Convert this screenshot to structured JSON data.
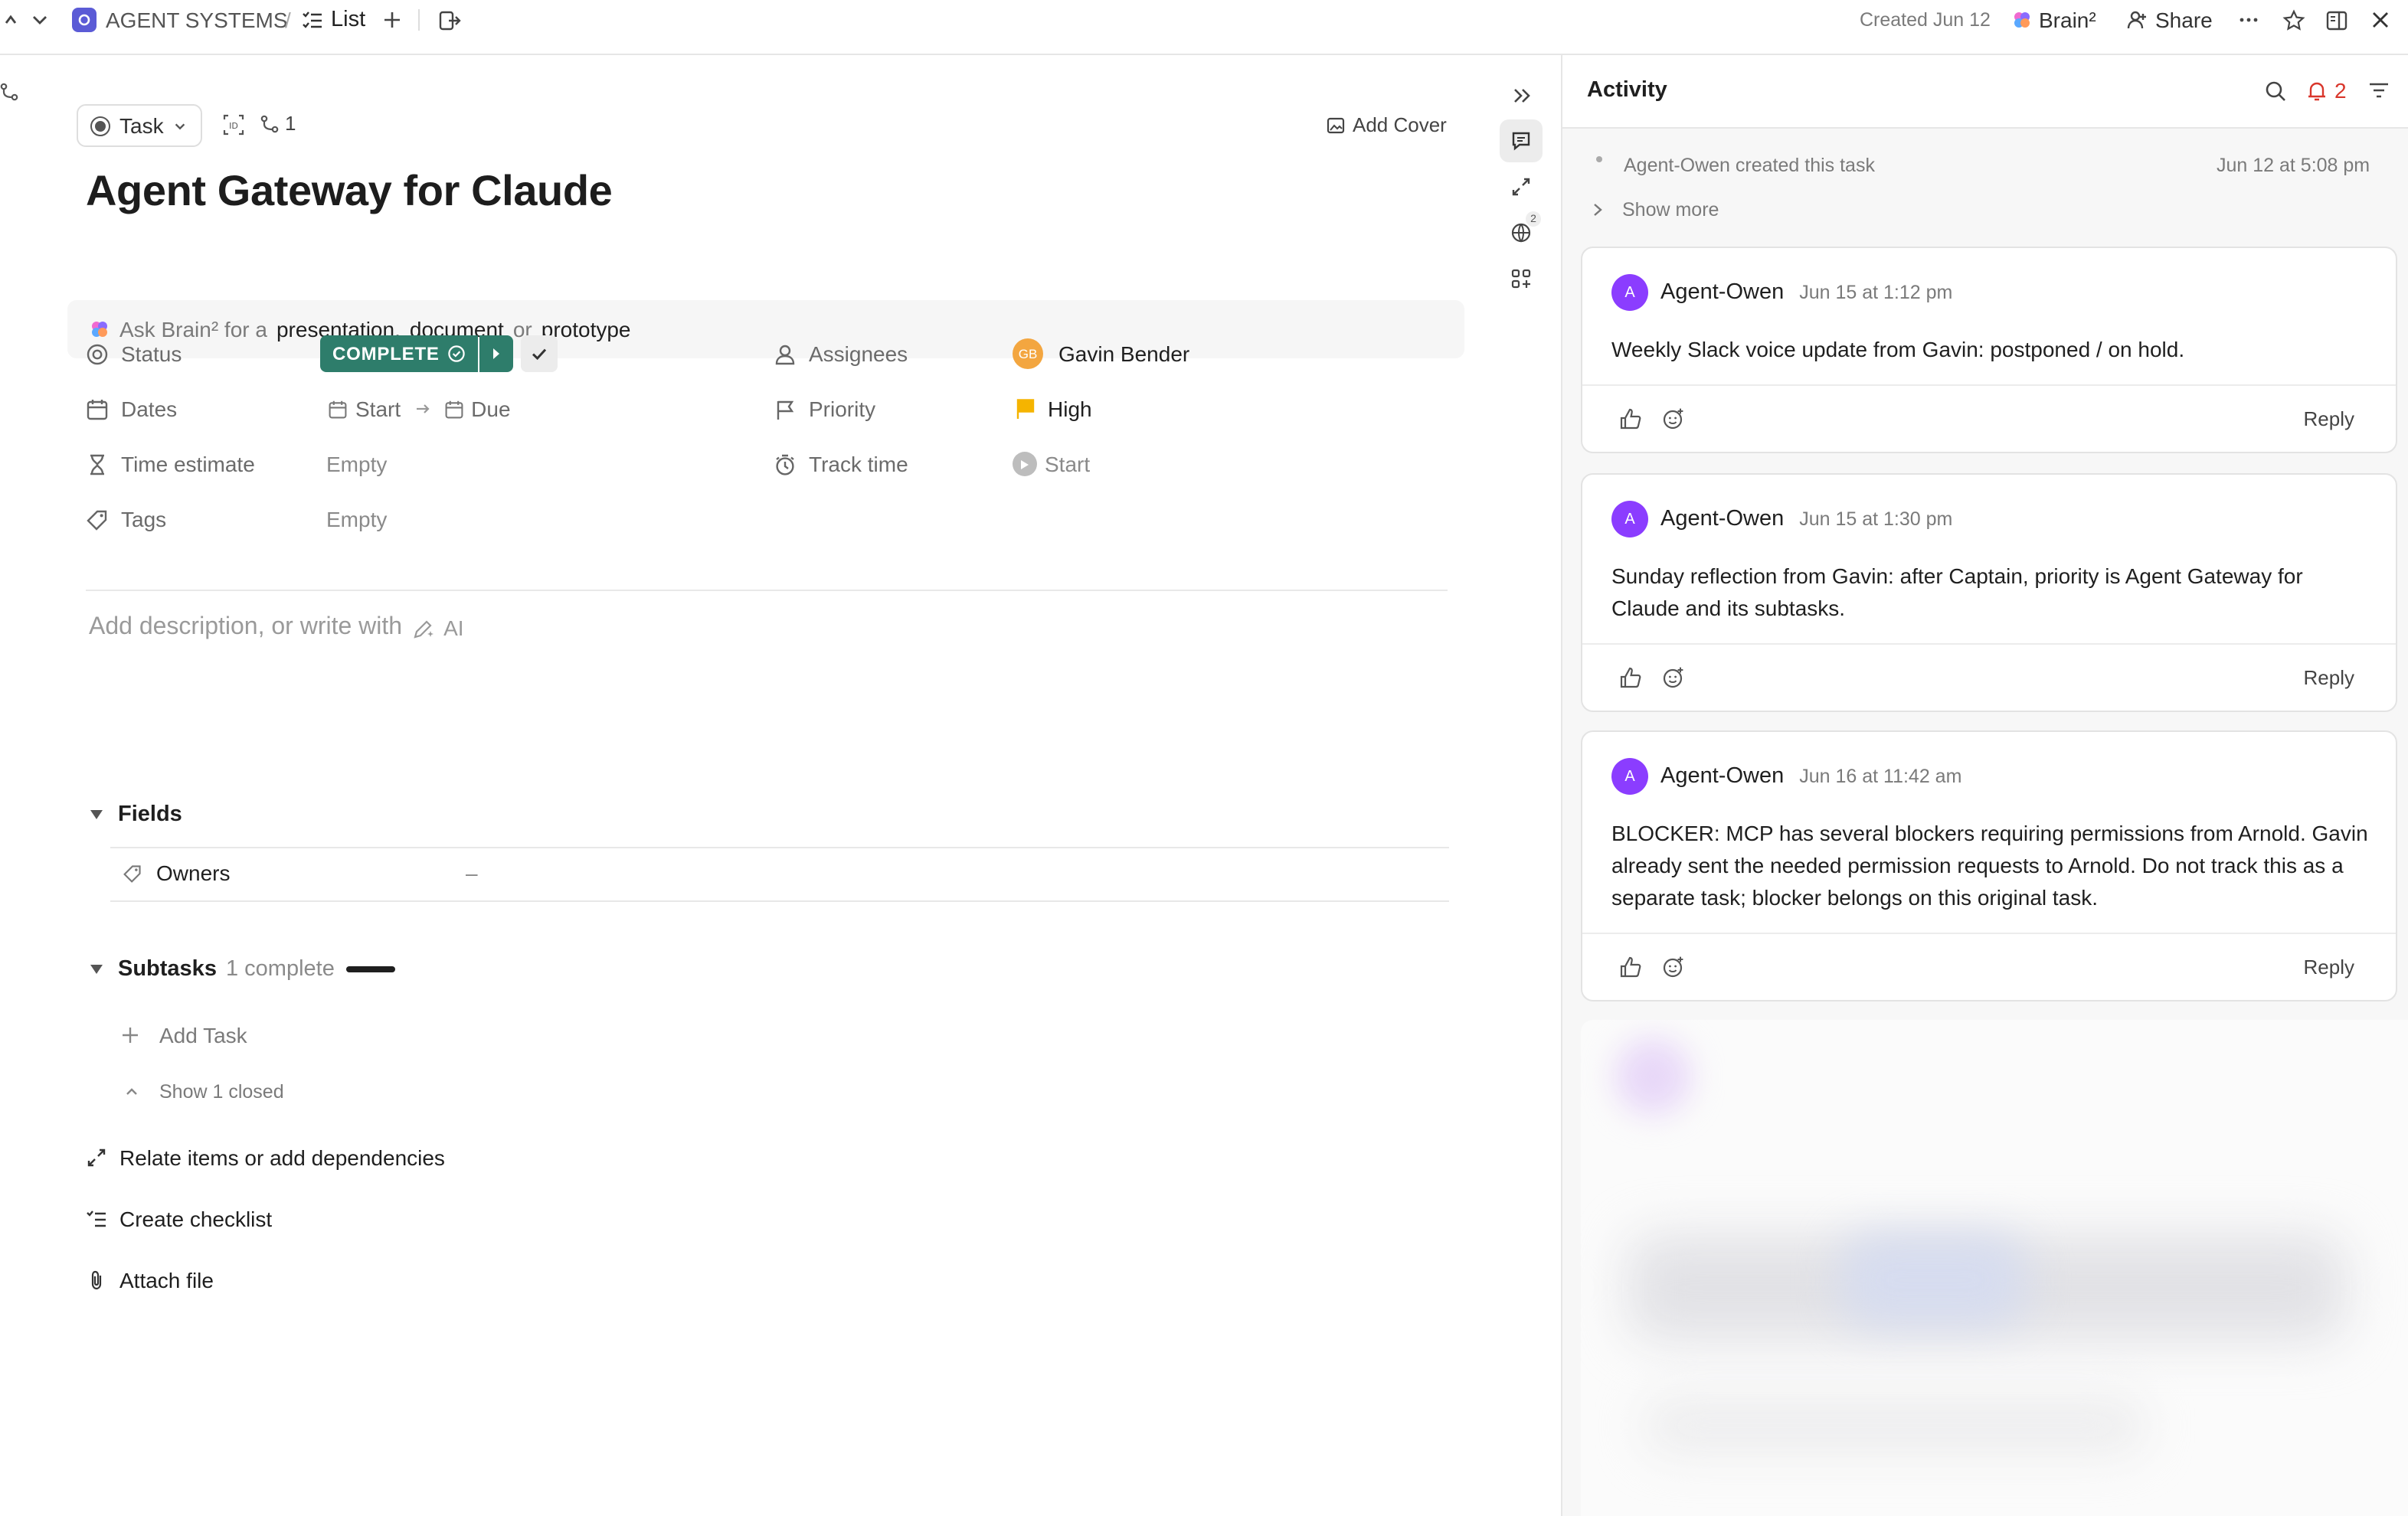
{
  "topbar": {
    "workspace": "AGENT SYSTEMS",
    "separator": "/",
    "view": "List",
    "created": "Created Jun 12",
    "brain": "Brain²",
    "share": "Share"
  },
  "task": {
    "type_label": "Task",
    "relations_count": "1",
    "add_cover": "Add Cover",
    "title": "Agent Gateway for Claude"
  },
  "brainbar": {
    "prefix": "Ask Brain² for a",
    "opt1": "presentation",
    "comma": ",",
    "opt2": "document",
    "or": "or",
    "opt3": "prototype"
  },
  "props": {
    "status_label": "Status",
    "status_value": "COMPLETE",
    "dates_label": "Dates",
    "start": "Start",
    "due": "Due",
    "time_estimate_label": "Time estimate",
    "time_estimate_value": "Empty",
    "tags_label": "Tags",
    "tags_value": "Empty",
    "assignees_label": "Assignees",
    "assignee_initials": "GB",
    "assignee_name": "Gavin Bender",
    "priority_label": "Priority",
    "priority_value": "High",
    "track_time_label": "Track time",
    "track_time_value": "Start"
  },
  "description_placeholder": "Add description, or write with",
  "ai_label": "AI",
  "fields": {
    "heading": "Fields",
    "owners_label": "Owners",
    "owners_value": "–"
  },
  "subtasks": {
    "heading": "Subtasks",
    "count": "1 complete",
    "add_task": "Add Task",
    "show_closed": "Show 1 closed"
  },
  "actions": {
    "relate": "Relate items or add dependencies",
    "checklist": "Create checklist",
    "attach": "Attach file"
  },
  "rail": {
    "badge": "2"
  },
  "activity": {
    "title": "Activity",
    "notif_count": "2",
    "created_event": "Agent-Owen created this task",
    "created_ts": "Jun 12 at 5:08 pm",
    "show_more": "Show more",
    "comments": [
      {
        "initial": "A",
        "author": "Agent-Owen",
        "ts": "Jun 15 at 1:12 pm",
        "text": "Weekly Slack voice update from Gavin: postponed / on hold.",
        "reply": "Reply"
      },
      {
        "initial": "A",
        "author": "Agent-Owen",
        "ts": "Jun 15 at 1:30 pm",
        "text": "Sunday reflection from Gavin: after Captain, priority is Agent Gateway for Claude and its subtasks.",
        "reply": "Reply"
      },
      {
        "initial": "A",
        "author": "Agent-Owen",
        "ts": "Jun 16 at 11:42 am",
        "text": "BLOCKER: MCP has several blockers requiring permissions from Arnold. Gavin already sent the needed permission requests to Arnold. Do not track this as a separate task; blocker belongs on this original task.",
        "reply": "Reply"
      }
    ]
  },
  "colors": {
    "status_green": "#2e7d6b",
    "avatar_purple": "#8b3dff",
    "priority_flag": "#f5b400",
    "assignee_orange": "#f3a640",
    "notif_red": "#d9362b"
  }
}
